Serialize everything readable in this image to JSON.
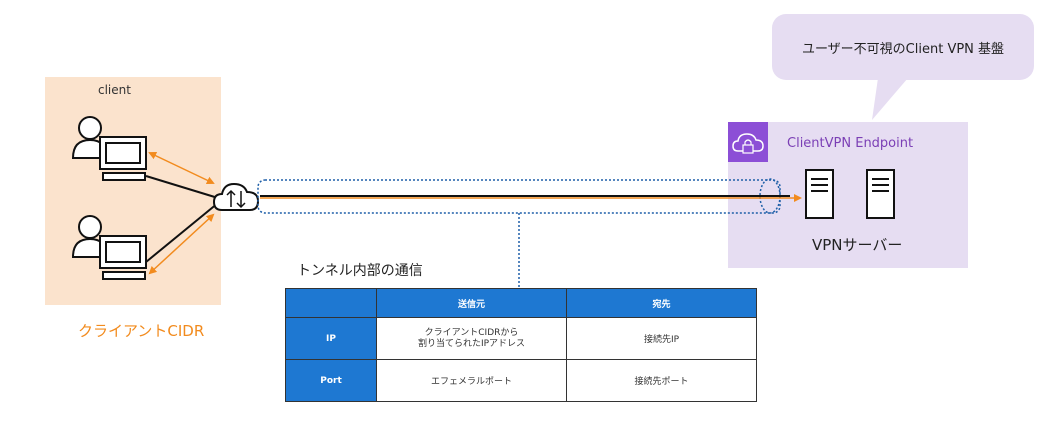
{
  "callout": {
    "text": "ユーザー不可視のClient VPN 基盤"
  },
  "client_area": {
    "label": "client",
    "cidr_label": "クライアントCIDR"
  },
  "vpn_area": {
    "endpoint_label": "ClientVPN Endpoint",
    "server_label": "VPNサーバー"
  },
  "tunnel": {
    "label": "トンネル内部の通信"
  },
  "table": {
    "headers": [
      "",
      "送信元",
      "宛先"
    ],
    "rows": [
      {
        "label": "IP",
        "source_line1": "クライアントCIDRから",
        "source_line2": "割り当てられたIPアドレス",
        "dest": "接続先IP"
      },
      {
        "label": "Port",
        "source_line1": "エフェメラルポート",
        "dest": "接続先ポート"
      }
    ]
  },
  "colors": {
    "client_bg": "#fbe3cd",
    "vpn_bg": "#e6ddf2",
    "accent_orange": "#f28b1e",
    "table_header": "#1e78d2",
    "tunnel_blue": "#1e5fa8",
    "endpoint_purple": "#7b3fb5"
  },
  "icons": [
    "user-icon",
    "laptop-icon",
    "cloud-icon",
    "lock-icon",
    "server-icon"
  ]
}
